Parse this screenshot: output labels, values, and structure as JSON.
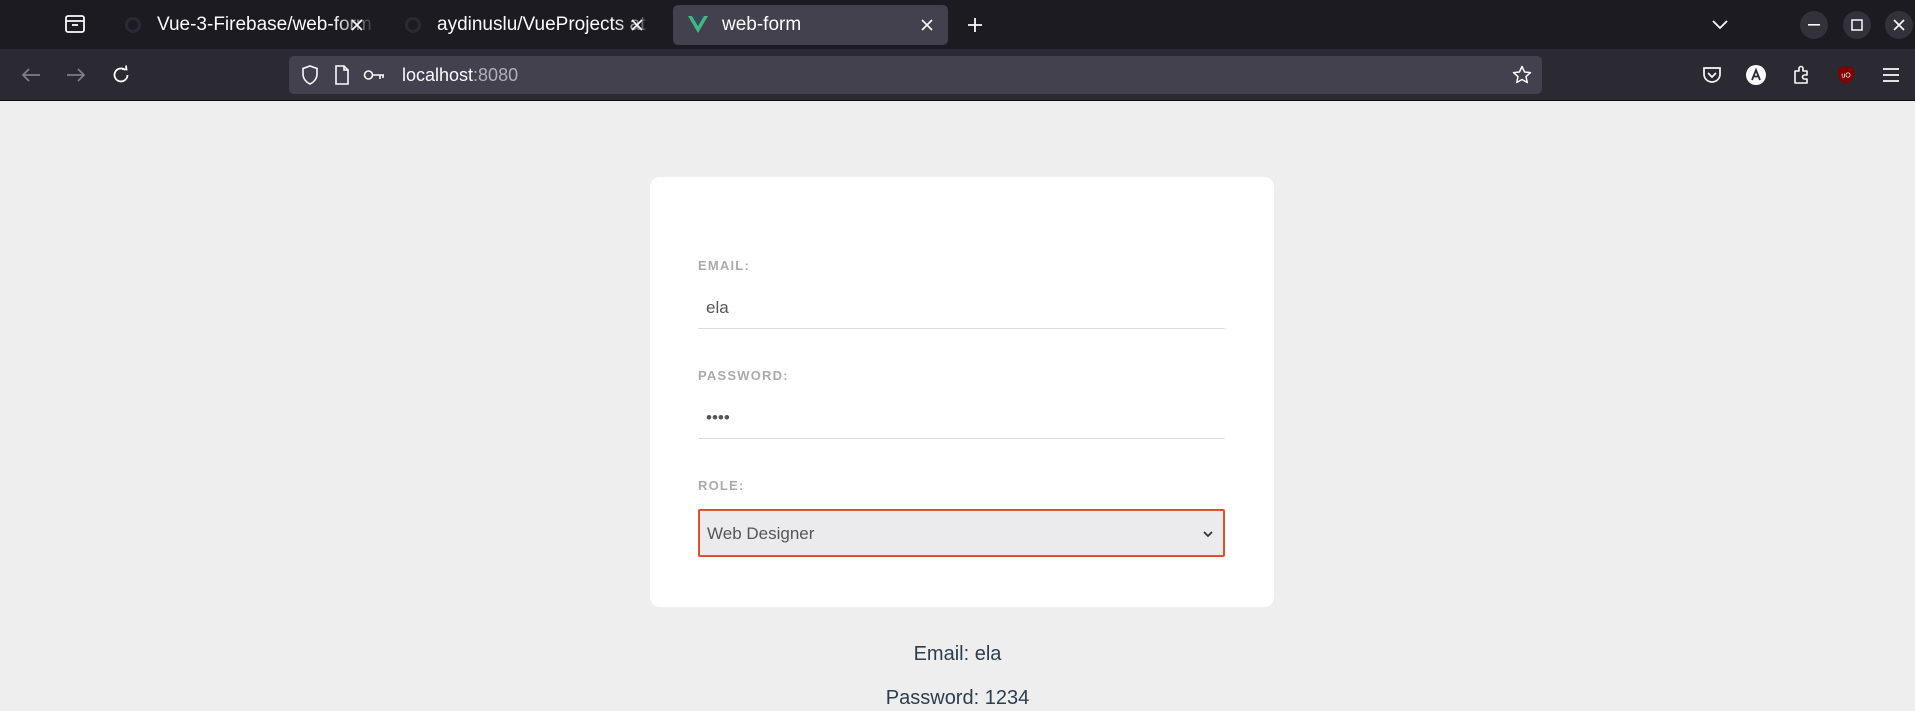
{
  "browser": {
    "tabs": [
      {
        "title": "Vue-3-Firebase/web-form",
        "icon": "github-icon",
        "active": false
      },
      {
        "title": "aydinuslu/VueProjects at",
        "icon": "github-icon",
        "active": false
      },
      {
        "title": "web-form",
        "icon": "vue-icon",
        "active": true
      }
    ],
    "url_host": "localhost",
    "url_port": ":8080"
  },
  "colors": {
    "chrome_dark": "#1c1b22",
    "toolbar": "#2b2a33",
    "active_tab": "#42414d",
    "page_bg": "#eeeeee",
    "select_border": "#e2502a",
    "vue_green": "#41b883",
    "output_text": "#2c3e50"
  },
  "form": {
    "email_label": "EMAIL:",
    "email_value": "ela",
    "password_label": "PASSWORD:",
    "password_mask": "••••",
    "role_label": "ROLE:",
    "role_value": "Web Designer"
  },
  "output": {
    "email_line": "Email: ela",
    "password_line": "Password: 1234"
  }
}
